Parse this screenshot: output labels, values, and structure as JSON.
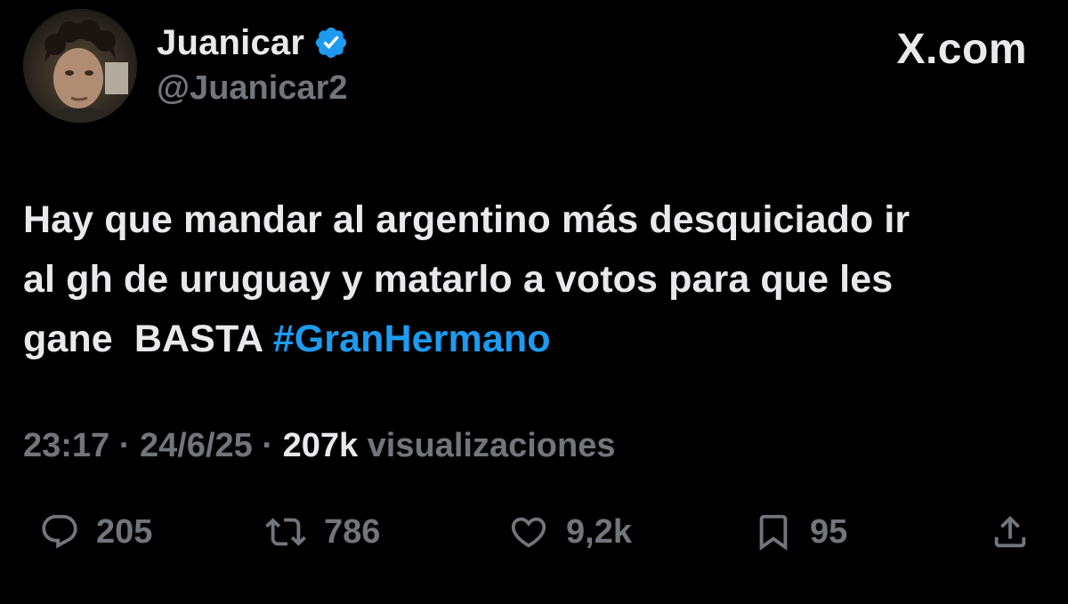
{
  "author": {
    "display_name": "Juanicar",
    "handle": "@Juanicar2",
    "verified": true
  },
  "site_mark": "X.com",
  "tweet": {
    "text_line1": "Hay que mandar al argentino más desquiciado ir",
    "text_line2": "al gh de uruguay y matarlo a votos para que les",
    "text_line3_prefix": "gane  BASTA ",
    "hashtag": "#GranHermano"
  },
  "meta": {
    "time": "23:17",
    "separator": "·",
    "date": "24/6/25",
    "views_count": "207k",
    "views_label": "visualizaciones"
  },
  "actions": {
    "replies": "205",
    "reposts": "786",
    "likes": "9,2k",
    "bookmarks": "95"
  },
  "colors": {
    "background": "#000000",
    "text_primary": "#e7e9ea",
    "text_secondary": "#71767b",
    "accent": "#1d9bf0"
  },
  "icons": [
    "verified-badge-icon",
    "reply-icon",
    "repost-icon",
    "like-icon",
    "bookmark-icon",
    "share-icon"
  ]
}
